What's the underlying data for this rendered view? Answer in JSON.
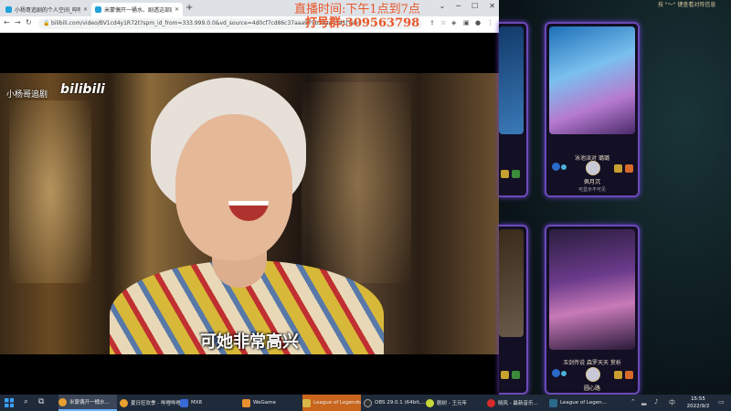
{
  "browser": {
    "tabs": [
      {
        "label": "小杨哥追剧的个人空间_哔哩哔哩_bilibili"
      },
      {
        "label": "米蒙偶开一桶水、剧透这部剧 - 哔哩哔哩"
      }
    ],
    "url": "bilibili.com/video/BV1cd4y1R72t?spm_id_from=333.999.0.0&vd_source=4d0cf7cd86c37aaa979b39ae0541f7ee",
    "video": {
      "watermark": "小杨哥追剧",
      "logo": "bilibili",
      "subtitle": "可她非常高兴"
    }
  },
  "overlay": {
    "schedule": "直播时间:下午1点到7点",
    "group": "打号群:309563798"
  },
  "game": {
    "topbar": "技 \"～\" 键查看对阵信息",
    "card_top": {
      "skin": "泳池派对 璐璐",
      "champion": "佩月沉",
      "note": "可显示不可见"
    },
    "card_bottom": {
      "skin": "玉剑传说 森罗天天 赏析",
      "champion": "圆心路"
    }
  },
  "taskbar": {
    "items": [
      "米蒙偶开一桶水...",
      "夏日狂欢季 - 哔哩哔哩...",
      "MX8",
      "WeGame",
      "League of Legends",
      "OBS 29.0.1 (64bit,...",
      "剧树 - 王元年",
      "晓风 - 最新音乐...",
      "League of Legen..."
    ],
    "time": "15:55",
    "date": "2022/9/2"
  },
  "colors": {
    "overlay_text": "#e8572a",
    "card_border": "#6a4ab8",
    "taskbar": "#1f2a3a",
    "taskbar_highlight": "#c9651c"
  }
}
